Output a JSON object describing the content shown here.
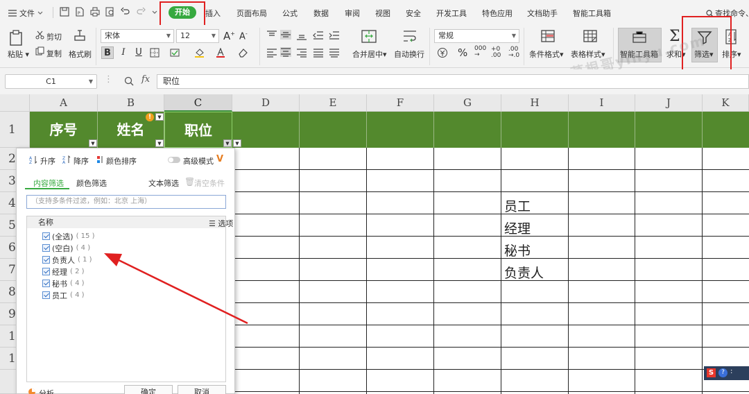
{
  "menubar": {
    "file_label": "文件",
    "tabs": [
      "开始",
      "插入",
      "页面布局",
      "公式",
      "数据",
      "审阅",
      "视图",
      "安全",
      "开发工具",
      "特色应用",
      "文档助手",
      "智能工具箱"
    ],
    "search_label": "查找命令、",
    "active_tab_color": "#36a93f"
  },
  "ribbon": {
    "paste": "粘贴",
    "cut": "剪切",
    "copy": "复制",
    "format_painter": "格式刷",
    "font_name": "宋体",
    "font_size": "12",
    "number_format": "常规",
    "merge_center": "合并居中",
    "wrap_text": "自动换行",
    "conditional_format": "条件格式",
    "table_style": "表格样式",
    "smart_toolbox": "智能工具箱",
    "sum": "求和",
    "filter": "筛选",
    "sort": "排序",
    "bold": "B",
    "italic": "I",
    "underline": "U",
    "font_grow": "A",
    "font_shrink": "A",
    "percent": "%"
  },
  "formula_bar": {
    "cell_ref": "C1",
    "fx": "fx",
    "content": "职位"
  },
  "sheet": {
    "columns": [
      "A",
      "B",
      "C",
      "D",
      "E",
      "F",
      "G",
      "H",
      "I",
      "J",
      "K"
    ],
    "rows": [
      "1",
      "2",
      "3",
      "4",
      "5",
      "6",
      "7",
      "8",
      "9",
      "1",
      "1"
    ],
    "headers": [
      "序号",
      "姓名",
      "职位"
    ],
    "header_color": "#53892d",
    "h_values": [
      "员工",
      "经理",
      "秘书",
      "负责人"
    ]
  },
  "filter_panel": {
    "sort_asc": "升序",
    "sort_desc": "降序",
    "color_sort": "颜色排序",
    "advanced_mode": "高级模式",
    "tab_content": "内容筛选",
    "tab_color": "颜色筛选",
    "text_filter": "文本筛选",
    "clear": "清空条件",
    "search_placeholder": "（支持多条件过滤，例如：北京 上海）",
    "list_header": "名称",
    "options": "选项",
    "items": [
      {
        "label": "(全选)",
        "count": "( 15 )"
      },
      {
        "label": "(空白)",
        "count": "( 4 )"
      },
      {
        "label": "负责人",
        "count": "( 1 )"
      },
      {
        "label": "经理",
        "count": "( 2 )"
      },
      {
        "label": "秘书",
        "count": "( 4 )"
      },
      {
        "label": "员工",
        "count": "( 4 )"
      }
    ],
    "analyze": "分析",
    "ok": "确定",
    "cancel": "取消"
  },
  "watermark": "草根哥yihyu.com",
  "annotation_color": "#e02020"
}
